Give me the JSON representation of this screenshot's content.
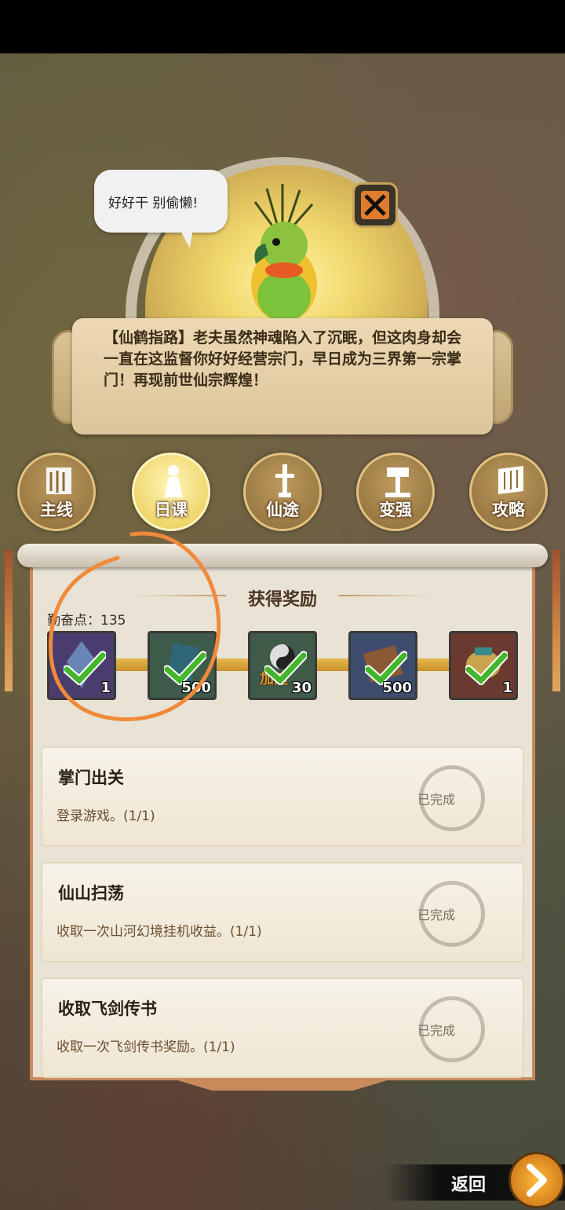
{
  "bubble": {
    "text": "好好干 别偷懒!"
  },
  "banner": {
    "text": "【仙鹤指路】老夫虽然神魂陷入了沉眠，但这肉身却会一直在这监督你好好经营宗门，早日成为三界第一宗掌门！再现前世仙宗辉煌！"
  },
  "tabs": [
    {
      "label": "主线",
      "icon": "map-scroll-icon",
      "active": false
    },
    {
      "label": "日课",
      "icon": "figure-icon",
      "active": true
    },
    {
      "label": "仙途",
      "icon": "sword-icon",
      "active": false
    },
    {
      "label": "变强",
      "icon": "hammer-icon",
      "active": false
    },
    {
      "label": "攻略",
      "icon": "open-scroll-icon",
      "active": false
    }
  ],
  "rewards": {
    "title": "获得奖励",
    "points_label": "勤奋点：135",
    "items": [
      {
        "qty": "1",
        "icon": "crystal-icon",
        "completed": true,
        "color": "#4a3d6e"
      },
      {
        "qty": "500",
        "icon": "jade-shard-icon",
        "completed": true,
        "color": "#3d5a4a"
      },
      {
        "qty": "30",
        "icon": "speedup-yinyang-icon",
        "completed": true,
        "color": "#3f5a49",
        "badge": "加速"
      },
      {
        "qty": "500",
        "icon": "scroll-book-icon",
        "completed": true,
        "color": "#3e4d6e"
      },
      {
        "qty": "1",
        "icon": "treasure-icon",
        "completed": true,
        "color": "#6a3a2f"
      }
    ]
  },
  "quests": [
    {
      "title": "掌门出关",
      "desc": "登录游戏。(1/1)",
      "status": "已完成"
    },
    {
      "title": "仙山扫荡",
      "desc": "收取一次山河幻境挂机收益。(1/1)",
      "status": "已完成"
    },
    {
      "title": "收取飞剑传书",
      "desc": "收取一次飞剑传书奖励。(1/1)",
      "status": "已完成"
    }
  ],
  "back": {
    "label": "返回"
  },
  "colors": {
    "accent": "#f08a3a",
    "gold": "#e7b94f",
    "panel_border": "#c98a5b"
  }
}
